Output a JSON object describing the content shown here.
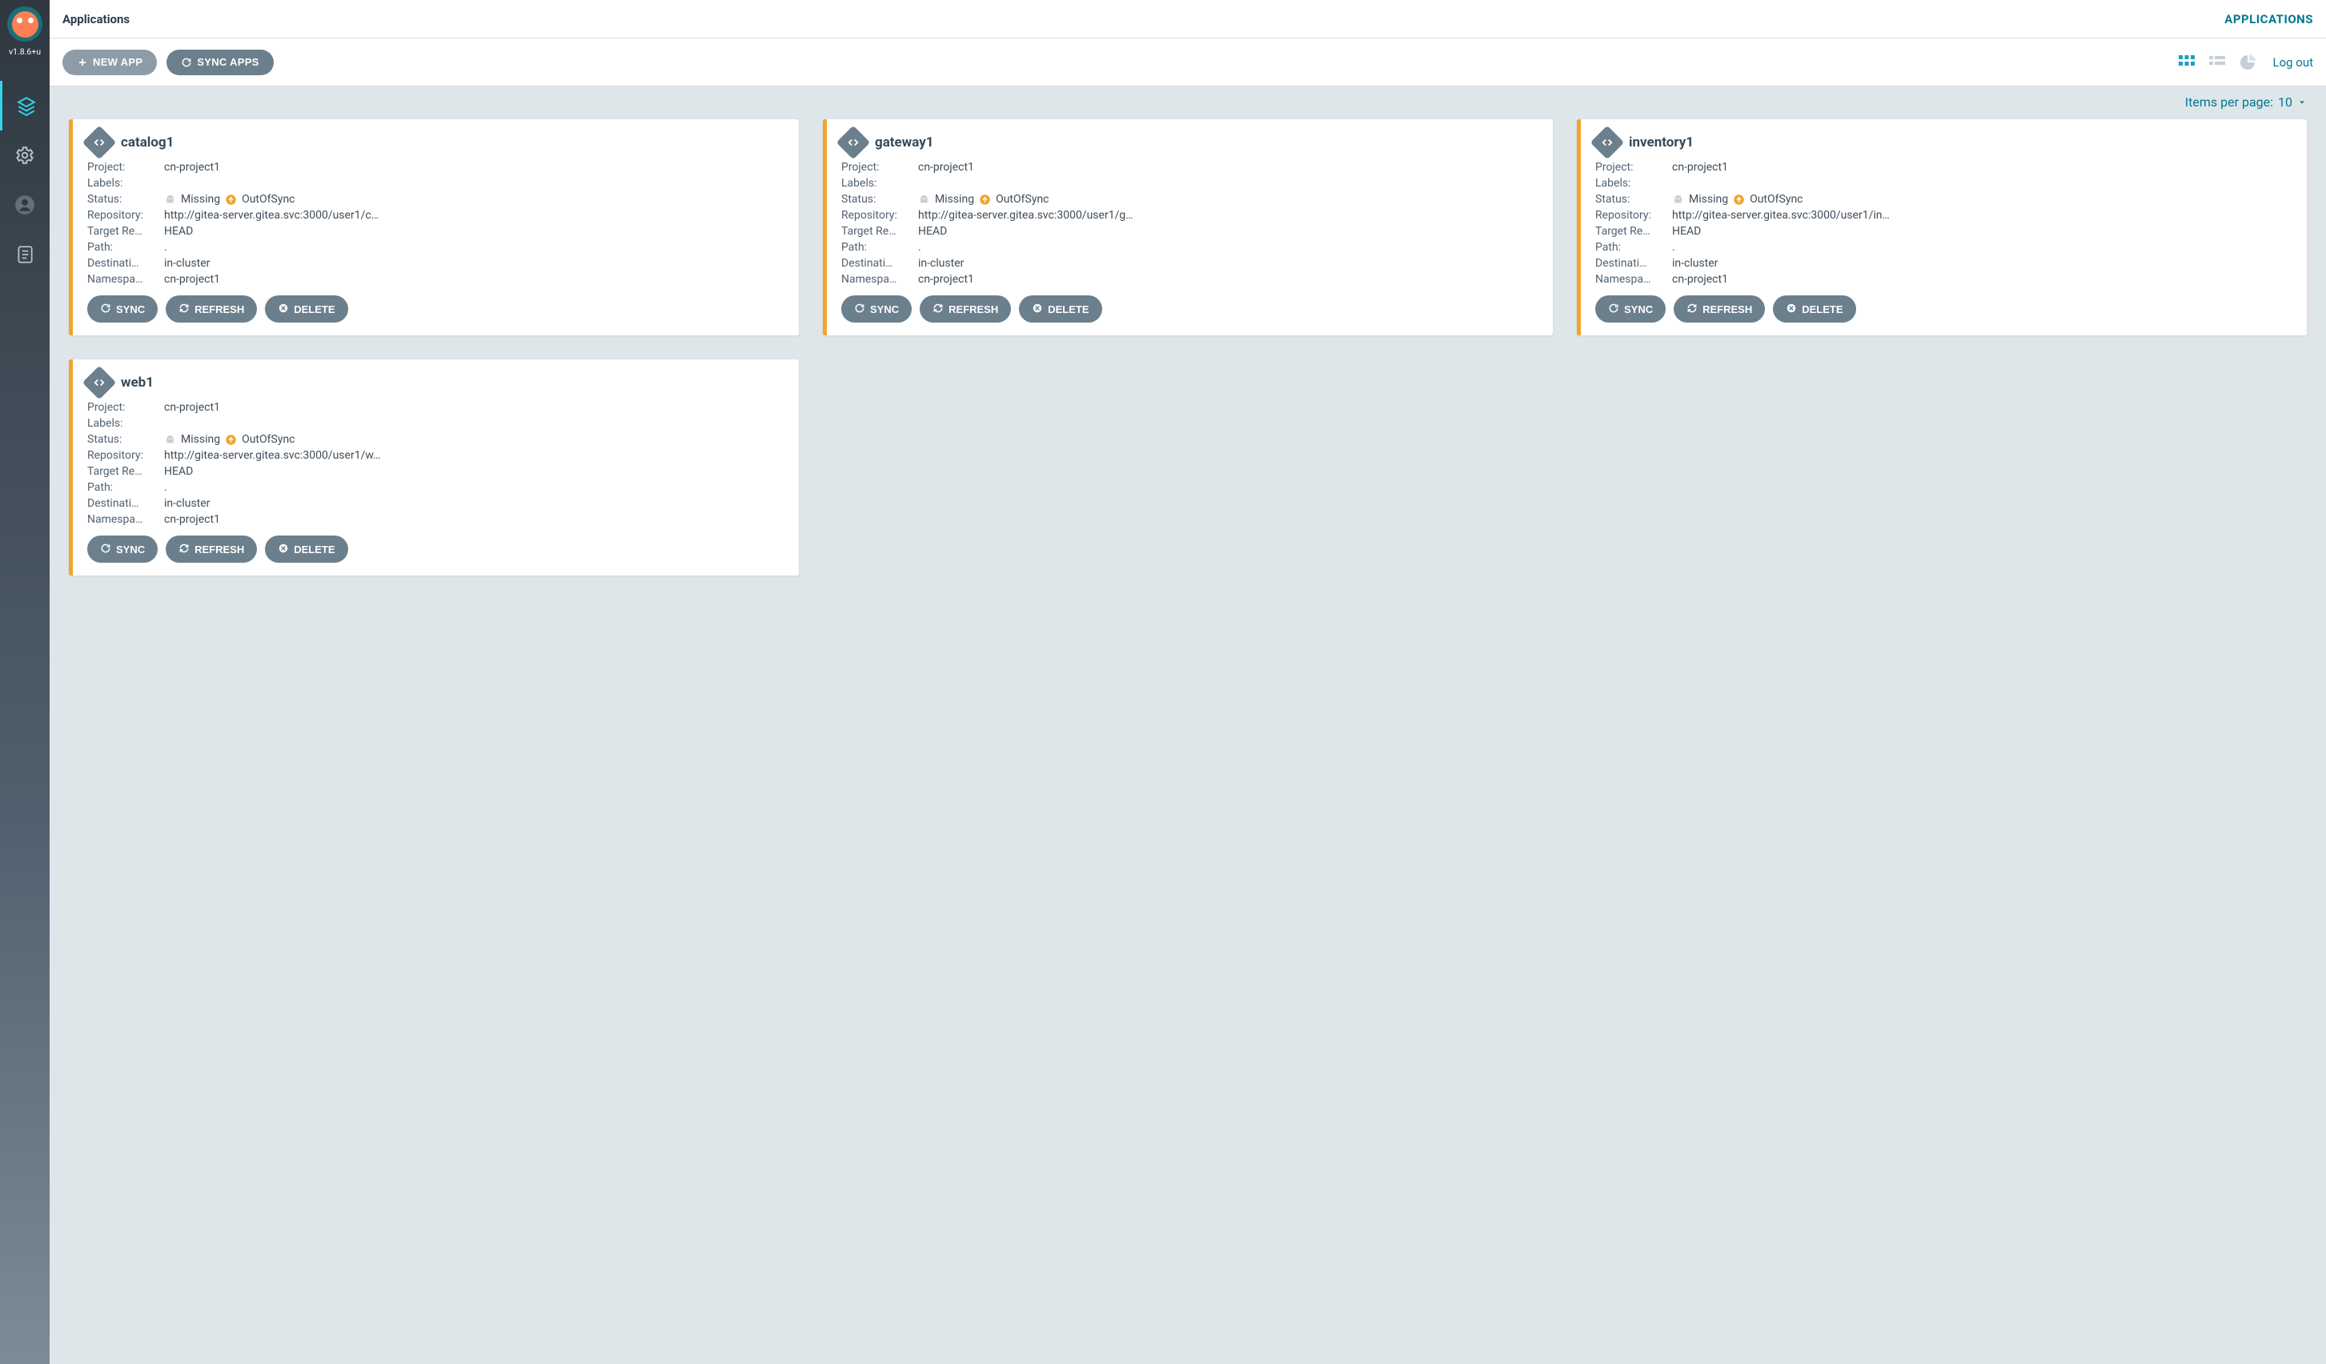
{
  "version": "v1.8.6+u",
  "header": {
    "title": "Applications",
    "top_link": "APPLICATIONS",
    "new_app": "NEW APP",
    "sync_apps": "SYNC APPS",
    "logout": "Log out"
  },
  "pager": {
    "label": "Items per page:",
    "value": "10"
  },
  "status_labels": {
    "missing": "Missing",
    "out_of_sync": "OutOfSync"
  },
  "row_labels": {
    "project": "Project:",
    "labels": "Labels:",
    "status": "Status:",
    "repository": "Repository:",
    "target_rev": "Target Re…",
    "path": "Path:",
    "destination": "Destinati…",
    "namespace": "Namespa…"
  },
  "action_labels": {
    "sync": "SYNC",
    "refresh": "REFRESH",
    "delete": "DELETE"
  },
  "apps": [
    {
      "name": "catalog1",
      "project": "cn-project1",
      "labels": "",
      "repository": "http://gitea-server.gitea.svc:3000/user1/c…",
      "target_rev": "HEAD",
      "path": ".",
      "destination": "in-cluster",
      "namespace": "cn-project1"
    },
    {
      "name": "gateway1",
      "project": "cn-project1",
      "labels": "",
      "repository": "http://gitea-server.gitea.svc:3000/user1/g…",
      "target_rev": "HEAD",
      "path": ".",
      "destination": "in-cluster",
      "namespace": "cn-project1"
    },
    {
      "name": "inventory1",
      "project": "cn-project1",
      "labels": "",
      "repository": "http://gitea-server.gitea.svc:3000/user1/in…",
      "target_rev": "HEAD",
      "path": ".",
      "destination": "in-cluster",
      "namespace": "cn-project1"
    },
    {
      "name": "web1",
      "project": "cn-project1",
      "labels": "",
      "repository": "http://gitea-server.gitea.svc:3000/user1/w…",
      "target_rev": "HEAD",
      "path": ".",
      "destination": "in-cluster",
      "namespace": "cn-project1"
    }
  ]
}
